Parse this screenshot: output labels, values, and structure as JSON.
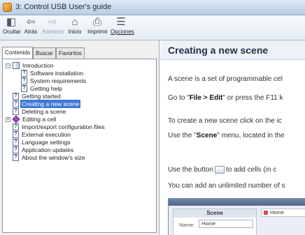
{
  "window": {
    "title": "3: Control USB User's guide"
  },
  "toolbar": {
    "buttons": [
      {
        "label": "Ocultar",
        "icon": "hide-pane-icon",
        "glyph": "◧",
        "enabled": true,
        "underline": false
      },
      {
        "label": "Atrás",
        "icon": "back-arrow-icon",
        "glyph": "⇦",
        "enabled": true,
        "underline": false
      },
      {
        "label": "Adelante",
        "icon": "forward-arrow-icon",
        "glyph": "⇨",
        "enabled": false,
        "underline": false
      },
      {
        "label": "Inicio",
        "icon": "home-icon",
        "glyph": "⌂",
        "enabled": true,
        "underline": false
      },
      {
        "label": "Imprimir",
        "icon": "printer-icon",
        "glyph": "⎙",
        "enabled": true,
        "underline": false
      },
      {
        "label": "Opciones",
        "icon": "options-icon",
        "glyph": "☰",
        "enabled": true,
        "underline": true
      }
    ]
  },
  "sidebar": {
    "tabs": [
      "Contenido",
      "Buscar",
      "Favoritos"
    ],
    "active_tab": "Contenido",
    "tree": [
      {
        "label": "Introduction",
        "icon": "book-icon",
        "expander": "−",
        "level": 0
      },
      {
        "label": "Software installation",
        "icon": "page-icon",
        "level": 1
      },
      {
        "label": "System requirements",
        "icon": "page-icon",
        "level": 1
      },
      {
        "label": "Getting help",
        "icon": "page-icon",
        "level": 1
      },
      {
        "label": "Getting started",
        "icon": "page-icon",
        "level": 0
      },
      {
        "label": "Creating a new scene",
        "icon": "page-icon",
        "level": 0,
        "selected": true
      },
      {
        "label": "Deleting a scene",
        "icon": "page-icon",
        "level": 0
      },
      {
        "label": "Editing a cell",
        "icon": "diamond-icon",
        "expander": "+",
        "level": 0
      },
      {
        "label": "Import/export configuration files",
        "icon": "page-icon",
        "level": 0
      },
      {
        "label": "External execution",
        "icon": "page-icon",
        "level": 0
      },
      {
        "label": "Language settings",
        "icon": "page-icon",
        "level": 0
      },
      {
        "label": "Application updates",
        "icon": "page-icon",
        "level": 0
      },
      {
        "label": "About the window's size",
        "icon": "page-icon",
        "level": 0
      }
    ]
  },
  "content": {
    "heading": "Creating a new scene",
    "para1": "A scene is a set of programmable cel",
    "para2_pre": "Go to \"",
    "para2_bold": "File > Edit",
    "para2_post": "\" or press the F11 k",
    "para3": "To create a new scene click on the ic",
    "para4_pre": "Use the \"",
    "para4_bold": "Scene",
    "para4_post": "\" menu, located in the",
    "para5_pre": "Use the button",
    "para5_post": "to add cells (in c",
    "para6": "You can add an unlimited number of s",
    "embedded": {
      "panel_title": "Scene",
      "name_label": "Name:",
      "name_value": "Home",
      "tab_label": "Home"
    }
  }
}
